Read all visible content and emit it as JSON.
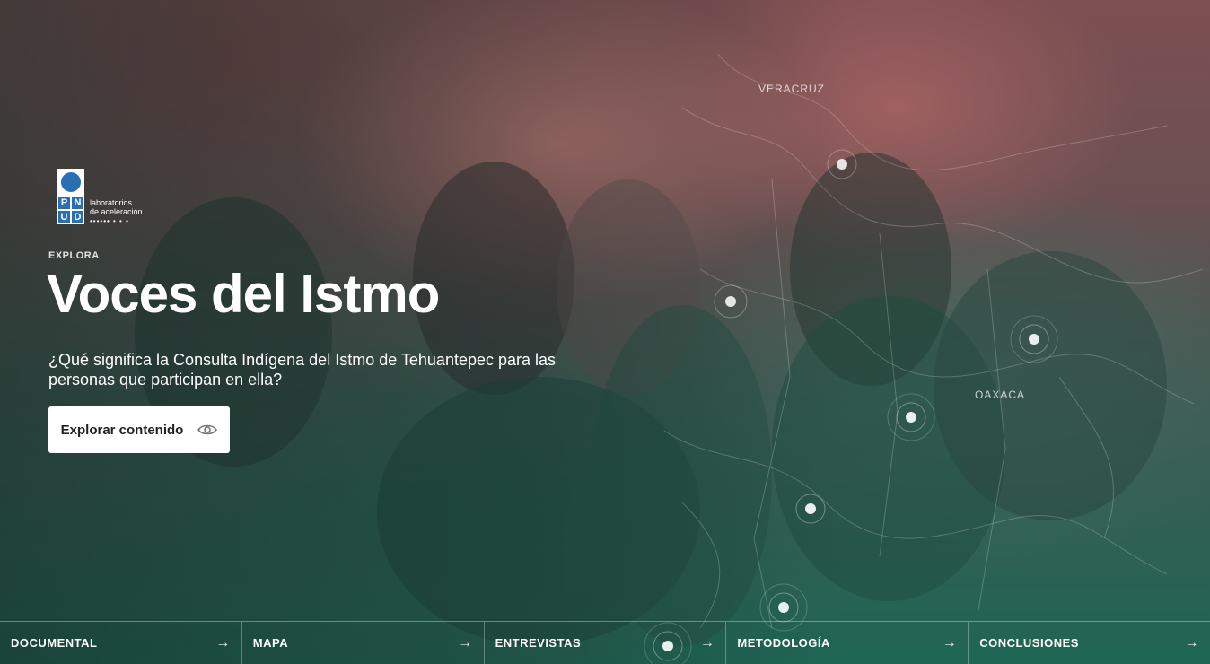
{
  "brand": {
    "grid_letters": [
      "P",
      "N",
      "U",
      "D"
    ],
    "line1": "laboratorios",
    "line2": "de aceleración",
    "dots": "•••••• • • •"
  },
  "hero": {
    "eyebrow": "EXPLORA",
    "title": "Voces del Istmo",
    "subtitle": "¿Qué significa la Consulta Indígena del Istmo de Tehuantepec para las personas que participan en ella?",
    "cta_label": "Explorar contenido"
  },
  "map": {
    "labels": [
      "VERACRUZ",
      "OAXACA"
    ]
  },
  "nav": {
    "items": [
      {
        "label": "DOCUMENTAL",
        "icon": "arrow-right-icon"
      },
      {
        "label": "MAPA",
        "icon": "arrow-right-icon"
      },
      {
        "label": "ENTREVISTAS",
        "icon": "arrow-right-icon"
      },
      {
        "label": "METODOLOGÍA",
        "icon": "arrow-right-icon"
      },
      {
        "label": "CONCLUSIONES",
        "icon": "arrow-right-icon"
      }
    ]
  },
  "colors": {
    "accent_pink": "#b87670",
    "accent_green": "#1f6655"
  }
}
